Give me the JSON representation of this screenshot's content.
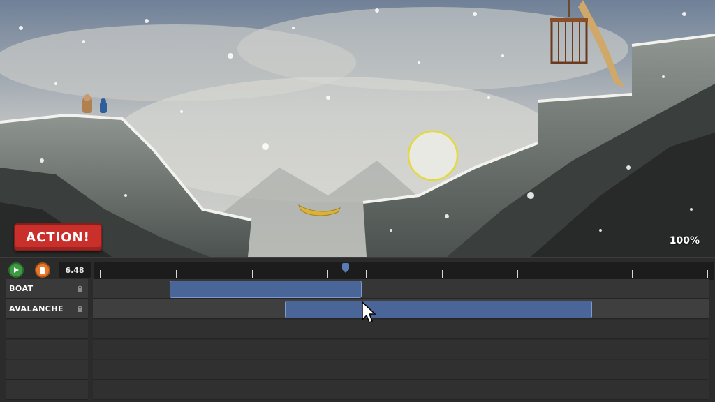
{
  "scene": {
    "action_button": "ACTION!",
    "zoom": "100%"
  },
  "timeline": {
    "time": "6.48",
    "playhead_seconds": 6.48,
    "tracks": [
      {
        "label": "BOAT",
        "locked": true
      },
      {
        "label": "AVALANCHE",
        "locked": true
      },
      {
        "label": ""
      },
      {
        "label": ""
      },
      {
        "label": ""
      },
      {
        "label": ""
      }
    ]
  },
  "icons": {
    "play": "play-icon",
    "document": "document-icon",
    "lock": "lock-icon"
  },
  "colors": {
    "action_red": "#c9302c",
    "clip_blue": "#4a6699",
    "play_green": "#3e9a43",
    "doc_orange": "#e8792b"
  }
}
